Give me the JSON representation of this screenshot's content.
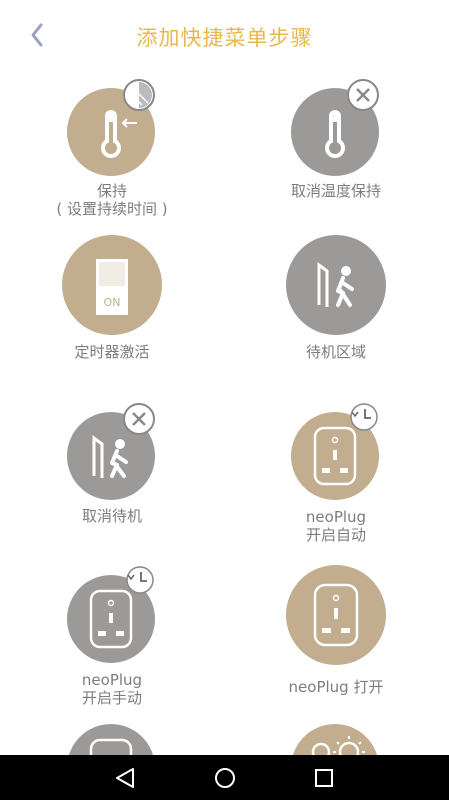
{
  "header": {
    "title": "添加快捷菜单步骤"
  },
  "items": [
    {
      "line1": "保持",
      "line2": "( 设置持续时间 )"
    },
    {
      "line1": "取消温度保持",
      "line2": ""
    },
    {
      "line1": "定时器激活",
      "line2": "",
      "switch_text": "ON"
    },
    {
      "line1": "待机区域",
      "line2": ""
    },
    {
      "line1": "取消待机",
      "line2": ""
    },
    {
      "line1": "neoPlug",
      "line2": "开启自动"
    },
    {
      "line1": "neoPlug",
      "line2": "开启手动"
    },
    {
      "line1": "neoPlug 打开",
      "line2": ""
    }
  ],
  "colors": {
    "accent": "#e8b84a",
    "tan": "#c2ad8e",
    "gray": "#9c9a99",
    "label": "#7d7d7d"
  },
  "icons": [
    "back-chevron-icon",
    "thermometer-icon",
    "close-icon",
    "timer-switch-icon",
    "standby-zone-icon",
    "plug-socket-icon",
    "clock-icon",
    "sun-icon"
  ],
  "navbar": {
    "buttons": [
      "back",
      "home",
      "recents"
    ]
  }
}
